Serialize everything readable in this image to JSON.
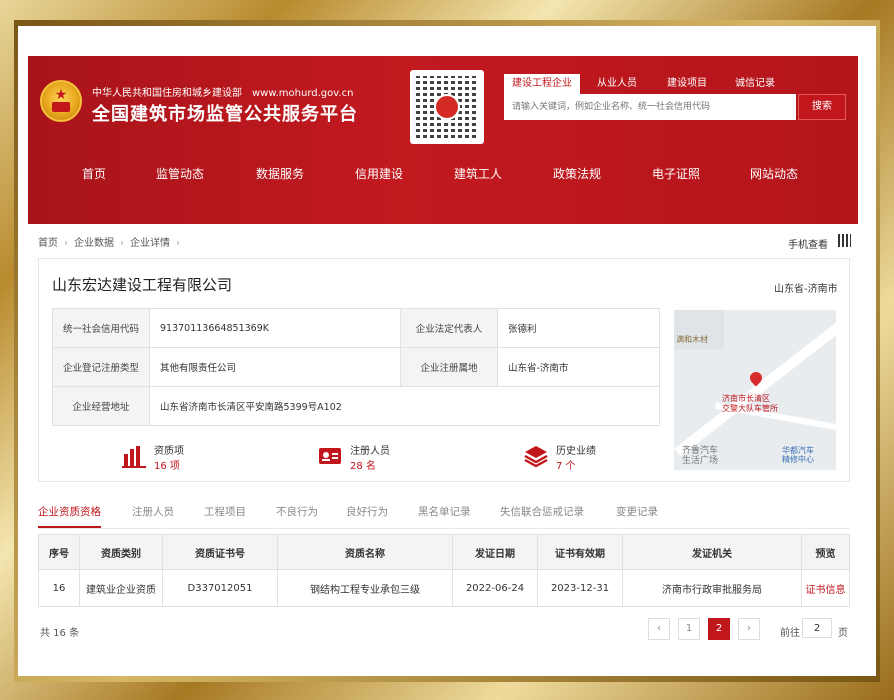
{
  "header": {
    "ministry": "中华人民共和国住房和城乡建设部",
    "url": "www.mohurd.gov.cn",
    "platform_title": "全国建筑市场监管公共服务平台",
    "search_tabs": [
      "建设工程企业",
      "从业人员",
      "建设项目",
      "诚信记录"
    ],
    "search_placeholder": "请输入关键词，例如企业名称、统一社会信用代码",
    "search_button": "搜索",
    "nav": [
      "首页",
      "监管动态",
      "数据服务",
      "信用建设",
      "建筑工人",
      "政策法规",
      "电子证照",
      "网站动态"
    ]
  },
  "breadcrumb": [
    "首页",
    "企业数据",
    "企业详情"
  ],
  "mobile_view": "手机查看",
  "company": {
    "name": "山东宏达建设工程有限公司",
    "location": "山东省-济南市",
    "info": {
      "credit_code_label": "统一社会信用代码",
      "credit_code": "91370113664851369K",
      "legal_rep_label": "企业法定代表人",
      "legal_rep": "张德利",
      "reg_type_label": "企业登记注册类型",
      "reg_type": "其他有限责任公司",
      "reg_place_label": "企业注册属地",
      "reg_place": "山东省-济南市",
      "address_label": "企业经营地址",
      "address": "山东省济南市长清区平安南路5399号A102"
    },
    "map_labels": {
      "a": "满和木材",
      "b": "济南市长清区",
      "b2": "交警大队车管所",
      "c": "齐鲁汽车",
      "c2": "生活广场",
      "d": "华都汽车",
      "d2": "精修中心"
    },
    "stats": [
      {
        "label": "资质项",
        "value": "16 项",
        "icon": "building-chart-icon"
      },
      {
        "label": "注册人员",
        "value": "28 名",
        "icon": "id-card-icon"
      },
      {
        "label": "历史业绩",
        "value": "7 个",
        "icon": "layers-icon"
      }
    ]
  },
  "tabs": [
    "企业资质资格",
    "注册人员",
    "工程项目",
    "不良行为",
    "良好行为",
    "黑名单记录",
    "失信联合惩戒记录",
    "变更记录"
  ],
  "table": {
    "headers": [
      "序号",
      "资质类别",
      "资质证书号",
      "资质名称",
      "发证日期",
      "证书有效期",
      "发证机关",
      "预览"
    ],
    "rows": [
      [
        "16",
        "建筑业企业资质",
        "D337012051",
        "钢结构工程专业承包三级",
        "2022-06-24",
        "2023-12-31",
        "济南市行政审批服务局",
        "证书信息"
      ]
    ]
  },
  "pagination": {
    "total": "共 16 条",
    "prev": "‹",
    "pages": [
      "1",
      "2"
    ],
    "current": "2",
    "next": "›",
    "goto_label": "前往",
    "goto_value": "2",
    "page_unit": "页"
  },
  "colors": {
    "brand_red": "#c0161c",
    "frame_gold": "#c9a24a"
  }
}
